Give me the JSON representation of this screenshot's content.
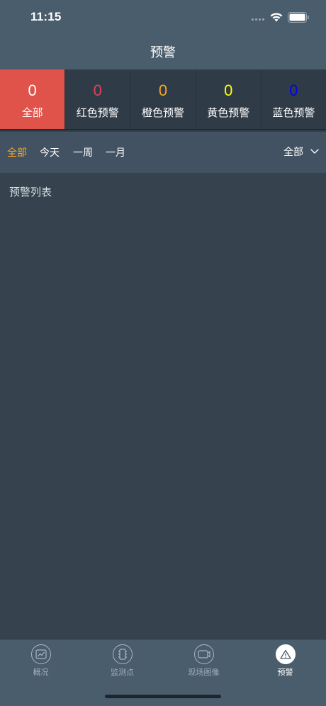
{
  "status_bar": {
    "time": "11:15"
  },
  "nav": {
    "title": "预警"
  },
  "stats": [
    {
      "count": "0",
      "label": "全部",
      "color": "#ffffff",
      "active": true
    },
    {
      "count": "0",
      "label": "红色预警",
      "color": "#e0405a"
    },
    {
      "count": "0",
      "label": "橙色预警",
      "color": "#f5a623"
    },
    {
      "count": "0",
      "label": "黄色预警",
      "color": "#ffff00"
    },
    {
      "count": "0",
      "label": "蓝色预警",
      "color": "#0000ee"
    }
  ],
  "filters": {
    "all": "全部",
    "today": "今天",
    "week": "一周",
    "month": "一月",
    "dropdown_value": "全部"
  },
  "list": {
    "title": "预警列表"
  },
  "tabs": [
    {
      "label": "概况",
      "icon": "chart-icon"
    },
    {
      "label": "监测点",
      "icon": "device-icon"
    },
    {
      "label": "现场图像",
      "icon": "camera-icon"
    },
    {
      "label": "预警",
      "icon": "warning-icon",
      "active": true
    }
  ]
}
